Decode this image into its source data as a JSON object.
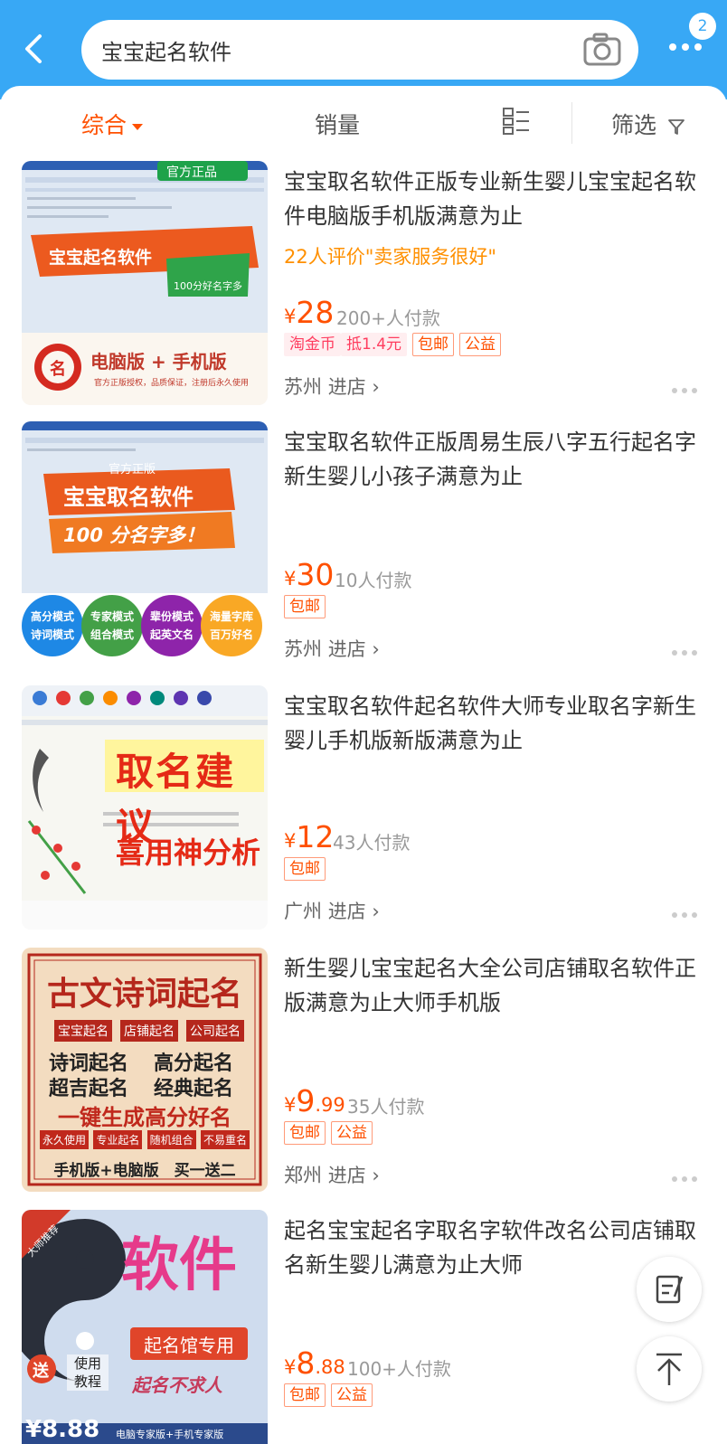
{
  "header": {
    "search_query": "宝宝起名软件",
    "badge_count": "2"
  },
  "sort": {
    "comprehensive": "综合",
    "sales": "销量",
    "filter": "筛选"
  },
  "products": [
    {
      "title": "宝宝取名软件正版专业新生婴儿宝宝起名软件电脑版手机版满意为止",
      "rating": "22人评价\"卖家服务很好\"",
      "price_int": "28",
      "price_dec": "",
      "sales": "200+人付款",
      "tags": [
        "淘金币",
        "抵1.4元",
        "包邮",
        "公益"
      ],
      "location": "苏州",
      "store_link": "进店",
      "img_text1": "官方正品",
      "img_text2": "宝宝起名软件",
      "img_text3": "100分好名字多",
      "img_text4": "名",
      "img_text5": "电脑版 + 手机版",
      "img_text6": "官方正版授权，品质保证，注册后永久使用"
    },
    {
      "title": "宝宝取名软件正版周易生辰八字五行起名字新生婴儿小孩子满意为止",
      "rating": "",
      "price_int": "30",
      "price_dec": "",
      "sales": "10人付款",
      "tags": [
        "包邮"
      ],
      "location": "苏州",
      "store_link": "进店",
      "img_text1": "官方正版",
      "img_text2": "宝宝取名软件",
      "img_text3": "100 分名字多！",
      "img_badges": [
        "高分模式 诗词模式",
        "专家模式 组合模式",
        "辈份模式 起英文名",
        "海量字库 百万好名"
      ]
    },
    {
      "title": "宝宝取名软件起名软件大师专业取名字新生婴儿手机版新版满意为止",
      "rating": "",
      "price_int": "12",
      "price_dec": "",
      "sales": "43人付款",
      "tags": [
        "包邮"
      ],
      "location": "广州",
      "store_link": "进店",
      "img_text1": "取名建议",
      "img_text2": "喜用神分析"
    },
    {
      "title": "新生婴儿宝宝起名大全公司店铺取名软件正版满意为止大师手机版",
      "rating": "",
      "price_int": "9",
      "price_dec": ".99",
      "sales": "35人付款",
      "tags": [
        "包邮",
        "公益"
      ],
      "location": "郑州",
      "store_link": "进店",
      "img_title": "古文诗词起名",
      "img_boxes": [
        "宝宝起名",
        "店铺起名",
        "公司起名"
      ],
      "img_lines": [
        "诗词起名",
        "高分起名",
        "超吉起名",
        "经典起名"
      ],
      "img_slogan": "一键生成高分好名",
      "img_small": [
        "永久使用",
        "专业起名",
        "随机组合",
        "不易重名"
      ],
      "img_bottom": "手机版+电脑版　买一送二"
    },
    {
      "title": "起名宝宝起名字取名字软件改名公司店铺取名新生婴儿满意为止大师",
      "rating": "",
      "price_int": "8",
      "price_dec": ".88",
      "sales": "100+人付款",
      "tags": [
        "包邮",
        "公益"
      ],
      "location": "",
      "store_link": "",
      "img_corner": "大师推荐",
      "img_big": "软件",
      "img_label": "起名馆专用",
      "img_send": "送",
      "img_tutorial": "使用 教程",
      "img_slogan": "起名不求人",
      "img_price": "¥8.88",
      "img_versions": "电脑专家版+手机专家版"
    }
  ]
}
